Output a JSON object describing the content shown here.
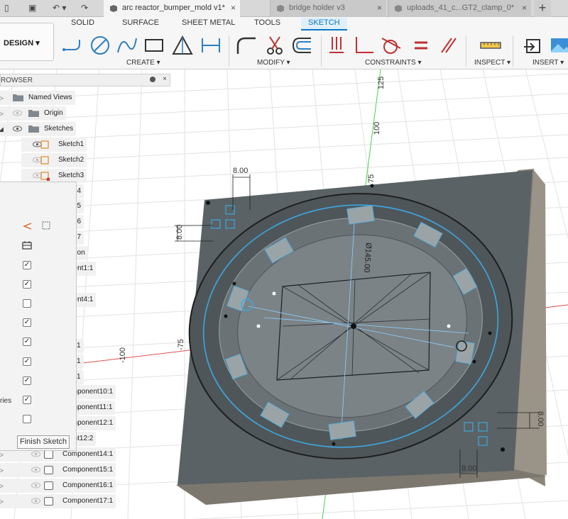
{
  "quick_access": {
    "file_icon": "file-icon",
    "save_icon": "save-icon",
    "undo_icon": "undo-icon",
    "redo_icon": "redo-icon"
  },
  "tabs": [
    {
      "label": "arc reactor_bumper_mold v1*",
      "close": "×"
    },
    {
      "label": "bridge holder v3",
      "close": "×"
    },
    {
      "label": "uploads_41_c...GT2_clamp_0*",
      "close": "×"
    }
  ],
  "tab_add": "+",
  "workspace": {
    "label": "DESIGN ▾"
  },
  "ribbon_tabs": [
    "SOLID",
    "SURFACE",
    "SHEET METAL",
    "TOOLS",
    "SKETCH"
  ],
  "ribbon_groups": {
    "create": "CREATE ▾",
    "modify": "MODIFY ▾",
    "constraints": "CONSTRAINTS ▾",
    "inspect": "INSPECT ▾",
    "insert": "INSERT ▾"
  },
  "browser": {
    "title": "ROWSER",
    "close": "×",
    "items": [
      {
        "label": "Named Views"
      },
      {
        "label": "Origin"
      },
      {
        "label": "Sketches"
      },
      {
        "label": "Sketch1"
      },
      {
        "label": "Sketch2"
      },
      {
        "label": "Sketch3"
      },
      {
        "label": "ch4"
      },
      {
        "label": "ch5"
      },
      {
        "label": "ch6"
      },
      {
        "label": "ch7"
      },
      {
        "label": "ation"
      },
      {
        "label": "nent1:1"
      },
      {
        "label": "1"
      },
      {
        "label": "nent4:1"
      },
      {
        "label": "1"
      },
      {
        "label": "1"
      },
      {
        "label": "1"
      },
      {
        "label": "Component10:1"
      },
      {
        "label": "Component11:1"
      },
      {
        "label": "Component12:1"
      },
      {
        "label": "ent12:2"
      },
      {
        "label": "Component14:1"
      },
      {
        "label": "Component15:1"
      },
      {
        "label": "Component16:1"
      },
      {
        "label": "Component17:1"
      }
    ]
  },
  "palette": {
    "options_label": "ries",
    "checkboxes": [
      "✓",
      "✓",
      "",
      "✓",
      "✓",
      "✓",
      "✓",
      "✓",
      ""
    ],
    "finish_label": "Finish Sketch"
  },
  "viewport": {
    "axis_labels": [
      "125",
      "100",
      "75",
      "-75",
      "-100"
    ],
    "dimensions": [
      "8.00",
      "8.00",
      "8.00",
      "8.00",
      "Ø145.00"
    ]
  },
  "colors": {
    "accent": "#0b75c4",
    "sketch_blue": "#3ea7e0",
    "block_gray": "#5b6366",
    "block_side": "#8f8a80"
  }
}
